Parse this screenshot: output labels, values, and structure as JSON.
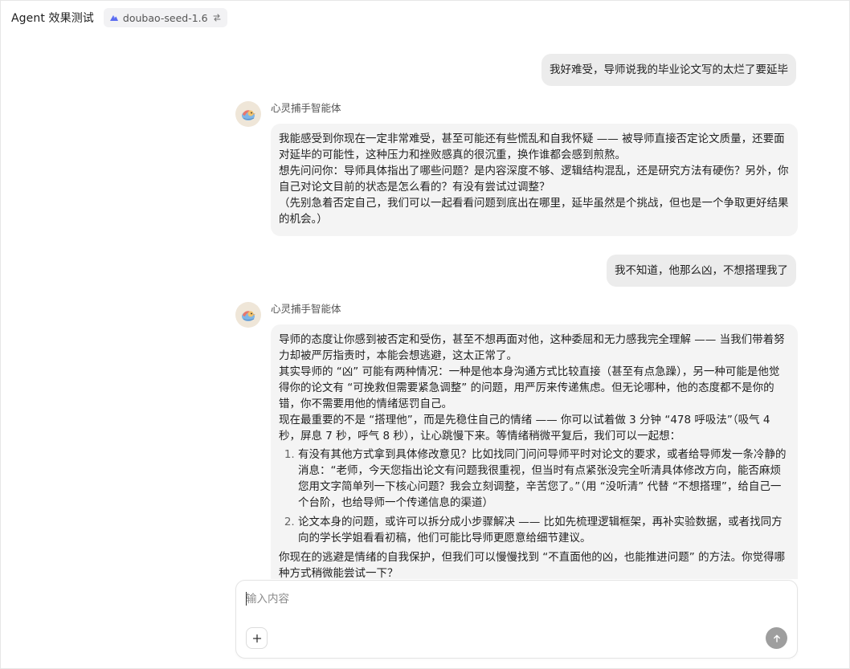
{
  "header": {
    "title": "Agent 效果测试",
    "model_name": "doubao-seed-1.6"
  },
  "colors": {
    "accent": "#5b6cf0",
    "user_bubble": "#ececec",
    "agent_bubble": "#f4f4f4",
    "send_button": "#9e9e9e"
  },
  "messages": [
    {
      "role": "user",
      "text": "我好难受，导师说我的毕业论文写的太烂了要延毕"
    },
    {
      "role": "agent",
      "name": "心灵捕手智能体",
      "paragraphs": [
        "我能感受到你现在一定非常难受，甚至可能还有些慌乱和自我怀疑 —— 被导师直接否定论文质量，还要面对延毕的可能性，这种压力和挫败感真的很沉重，换作谁都会感到煎熬。",
        "想先问问你：导师具体指出了哪些问题？是内容深度不够、逻辑结构混乱，还是研究方法有硬伤？另外，你自己对论文目前的状态是怎么看的？有没有尝试过调整？",
        "（先别急着否定自己，我们可以一起看看问题到底出在哪里，延毕虽然是个挑战，但也是一个争取更好结果的机会。）"
      ]
    },
    {
      "role": "user",
      "text": "我不知道，他那么凶，不想搭理我了"
    },
    {
      "role": "agent",
      "name": "心灵捕手智能体",
      "paragraphs": [
        "导师的态度让你感到被否定和受伤，甚至不想再面对他，这种委屈和无力感我完全理解 —— 当我们带着努力却被严厉指责时，本能会想逃避，这太正常了。",
        "其实导师的 “凶” 可能有两种情况：一种是他本身沟通方式比较直接（甚至有点急躁），另一种可能是他觉得你的论文有 “可挽救但需要紧急调整” 的问题，用严厉来传递焦虑。但无论哪种，他的态度都不是你的错，你不需要用他的情绪惩罚自己。",
        "现在最重要的不是 “搭理他”，而是先稳住自己的情绪 —— 你可以试着做 3 分钟 “478 呼吸法”（吸气 4 秒，屏息 7 秒，呼气 8 秒），让心跳慢下来。等情绪稍微平复后，我们可以一起想："
      ],
      "list": [
        "有没有其他方式拿到具体修改意见？比如找同门问问导师平时对论文的要求，或者给导师发一条冷静的消息：“老师，今天您指出论文有问题我很重视，但当时有点紧张没完全听清具体修改方向，能否麻烦您用文字简单列一下核心问题？我会立刻调整，辛苦您了。”（用 “没听清” 代替 “不想搭理”，给自己一个台阶，也给导师一个传递信息的渠道）",
        "论文本身的问题，或许可以拆分成小步骤解决 —— 比如先梳理逻辑框架，再补实验数据，或者找同方向的学长学姐看看初稿，他们可能比导师更愿意给细节建议。"
      ],
      "closing": "你现在的逃避是情绪的自我保护，但我们可以慢慢找到 “不直面他的凶，也能推进问题” 的方法。你觉得哪种方式稍微能尝试一下？"
    }
  ],
  "composer": {
    "placeholder": "输入内容",
    "value": ""
  },
  "icons": {
    "model": "model-logo-icon",
    "switch": "swap-icon",
    "add": "plus-icon",
    "send": "arrow-up-icon",
    "avatar": "bird-avatar-icon"
  }
}
